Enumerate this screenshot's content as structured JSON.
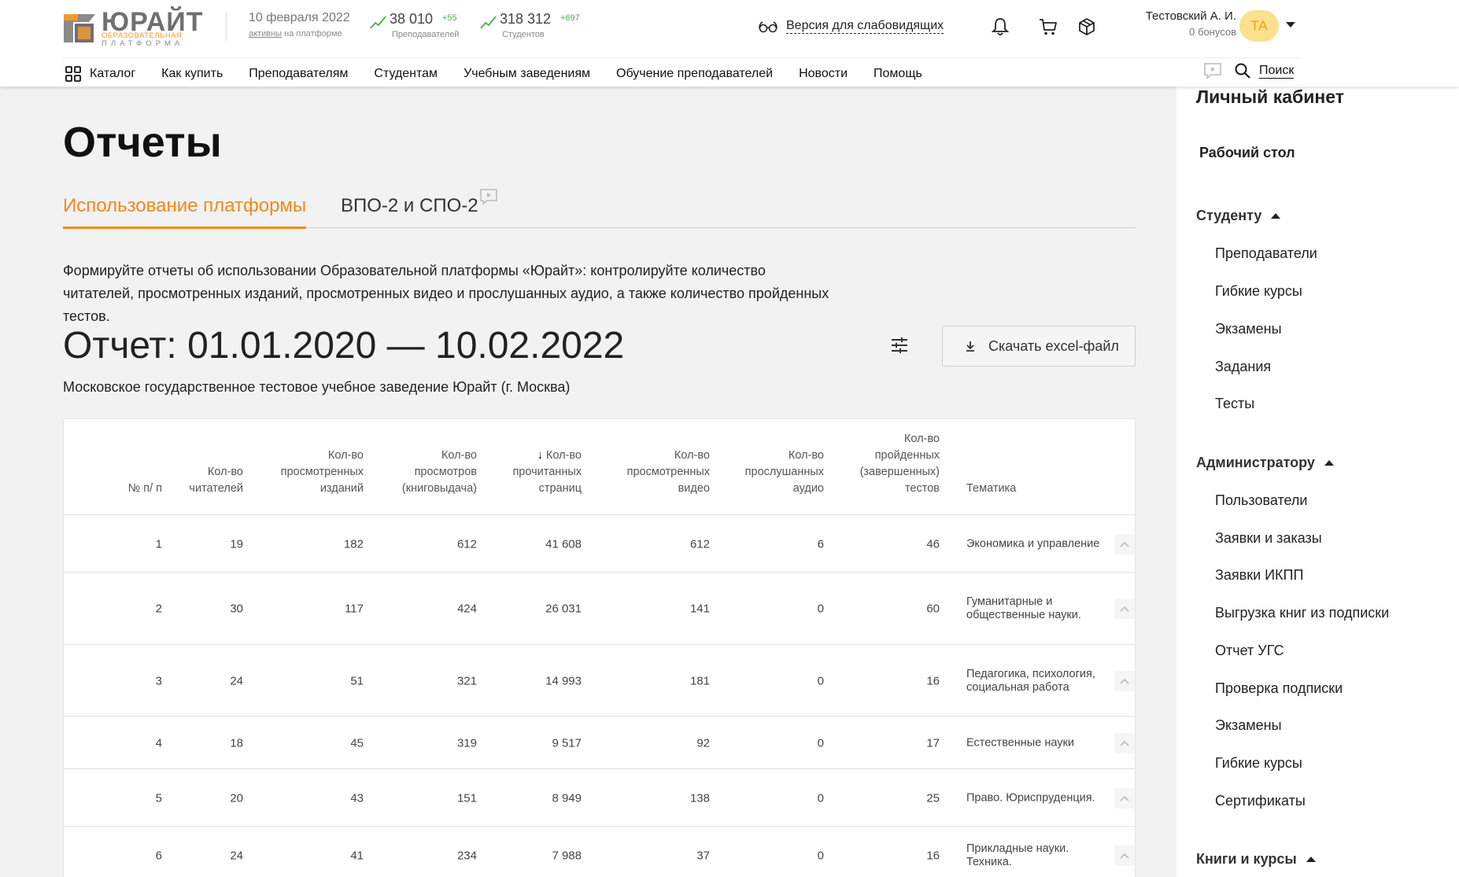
{
  "header": {
    "logo": {
      "main": "ЮРАЙТ",
      "sub1": "ОБРАЗОВАТЕЛЬНАЯ",
      "sub2": "ПЛАТФОРМА"
    },
    "date": {
      "value": "10 февраля 2022",
      "sub_link": "активны",
      "sub_rest": " на платформе"
    },
    "teachers": {
      "count": "38 010",
      "delta": "+55",
      "label": "Преподавателей"
    },
    "students": {
      "count": "318 312",
      "delta": "+697",
      "label": "Студентов"
    },
    "accessibility_label": "Версия для слабовидящих",
    "user": {
      "name": "Тестовский А. И.",
      "bonus": "0 бонусов",
      "initials": "ТА"
    },
    "accent": "#f08a1c",
    "trend_color": "#4caf50"
  },
  "nav": {
    "catalog": "Каталог",
    "items": [
      "Как купить",
      "Преподавателям",
      "Студентам",
      "Учебным заведениям",
      "Обучение преподавателей",
      "Новости",
      "Помощь"
    ],
    "search": "Поиск"
  },
  "page": {
    "title": "Отчеты",
    "tabs": [
      {
        "label": "Использование платформы",
        "active": true
      },
      {
        "label": "ВПО-2 и СПО-2",
        "active": false
      }
    ],
    "description": "Формируйте отчеты об использовании Образовательной платформы «Юрайт»: контролируйте количество читателей, просмотренных изданий, просмотренных видео и прослушанных аудио, а также количество пройденных тестов.",
    "report_title": "Отчет: 01.01.2020 — 10.02.2022",
    "organization": "Московское государственное тестовое учебное заведение Юрайт (г. Москва)",
    "download_label": "Скачать excel-файл"
  },
  "table": {
    "headers": [
      "№ п/ п",
      "Кол-во читателей",
      "Кол-во просмотренных изданий",
      "Кол-во просмотров (книговыдача)",
      "Кол-во прочитанных страниц",
      "Кол-во просмотренных видео",
      "Кол-во прослушанных аудио",
      "Кол-во пройденных (завершенных) тестов",
      "Тематика"
    ],
    "sort_arrow": "↓",
    "rows": [
      [
        "1",
        "19",
        "182",
        "612",
        "41 608",
        "612",
        "6",
        "46",
        "Экономика и управление"
      ],
      [
        "2",
        "30",
        "117",
        "424",
        "26 031",
        "141",
        "0",
        "60",
        "Гуманитарные и общественные науки."
      ],
      [
        "3",
        "24",
        "51",
        "321",
        "14 993",
        "181",
        "0",
        "16",
        "Педагогика, психология, социальная работа"
      ],
      [
        "4",
        "18",
        "45",
        "319",
        "9 517",
        "92",
        "0",
        "17",
        "Естественные науки"
      ],
      [
        "5",
        "20",
        "43",
        "151",
        "8 949",
        "138",
        "0",
        "25",
        "Право. Юриспруденция."
      ],
      [
        "6",
        "24",
        "41",
        "234",
        "7 988",
        "37",
        "0",
        "16",
        "Прикладные науки. Техника."
      ]
    ]
  },
  "sidebar": {
    "title": "Личный кабинет",
    "desk": "Рабочий стол",
    "sections": [
      {
        "label": "Студенту",
        "items": [
          "Преподаватели",
          "Гибкие курсы",
          "Экзамены",
          "Задания",
          "Тесты"
        ]
      },
      {
        "label": "Администратору",
        "items": [
          "Пользователи",
          "Заявки и заказы",
          "Заявки ИКПП",
          "Выгрузка книг из подписки",
          "Отчет УГС",
          "Проверка подписки",
          "Экзамены",
          "Гибкие курсы",
          "Сертификаты"
        ]
      },
      {
        "label": "Книги и курсы",
        "items": []
      }
    ]
  }
}
